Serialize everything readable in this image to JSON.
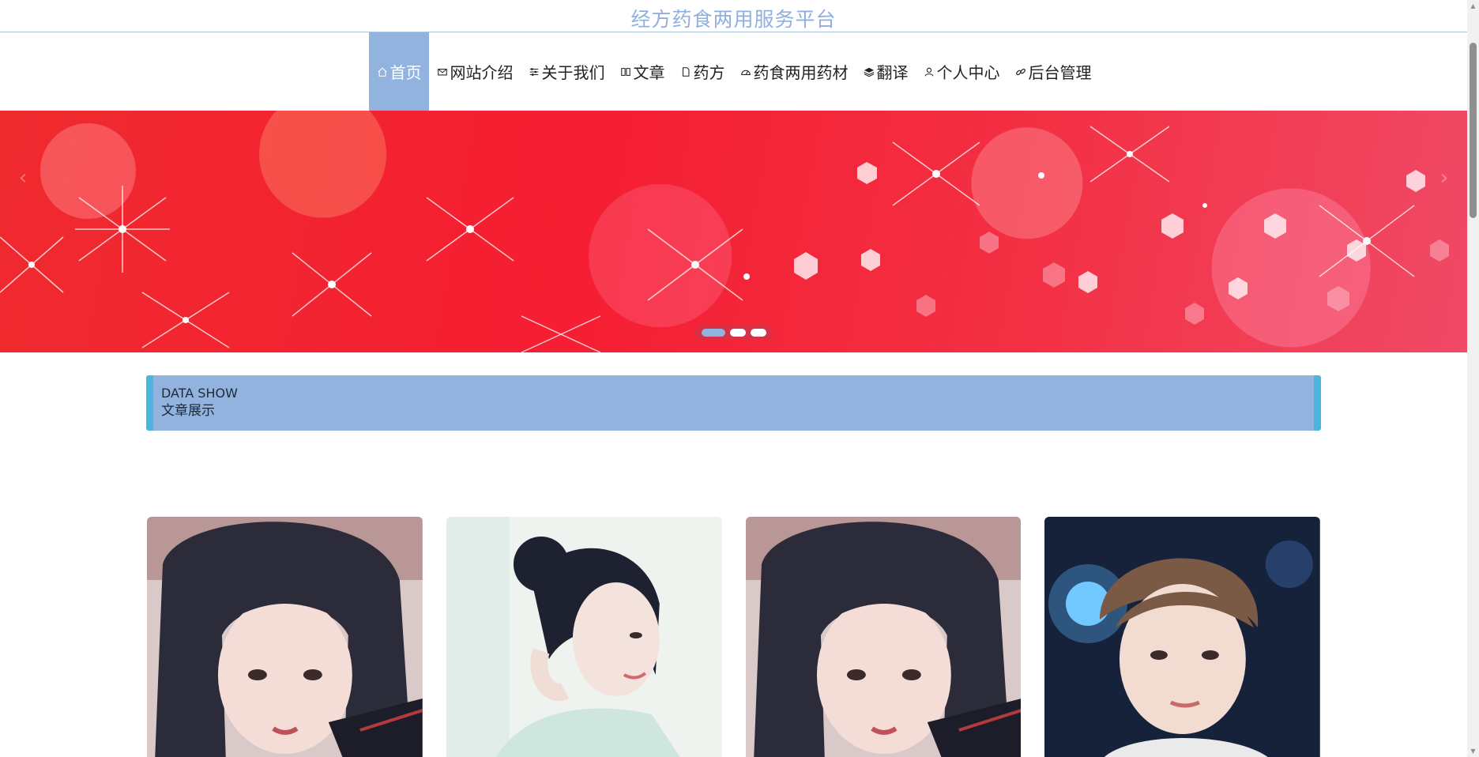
{
  "site": {
    "title": "经方药食两用服务平台"
  },
  "nav": {
    "items": [
      {
        "label": "首页",
        "icon": "home-icon",
        "active": true
      },
      {
        "label": "网站介绍",
        "icon": "envelope-icon",
        "active": false
      },
      {
        "label": "关于我们",
        "icon": "sliders-icon",
        "active": false
      },
      {
        "label": "文章",
        "icon": "book-icon",
        "active": false
      },
      {
        "label": "药方",
        "icon": "document-icon",
        "active": false
      },
      {
        "label": "药食两用药材",
        "icon": "gauge-icon",
        "active": false
      },
      {
        "label": "翻译",
        "icon": "layers-icon",
        "active": false
      },
      {
        "label": "个人中心",
        "icon": "user-icon",
        "active": false
      },
      {
        "label": "后台管理",
        "icon": "link-icon",
        "active": false
      }
    ]
  },
  "banner": {
    "slide_count": 3,
    "active_slide": 1,
    "colors": {
      "base": "#f51e32",
      "accent": "#93b3df"
    }
  },
  "section": {
    "title_en": "DATA SHOW",
    "title_cn": "文章展示"
  },
  "articles": [
    {
      "image": "portrait-girl-black-hair"
    },
    {
      "image": "portrait-woman-hair-bun"
    },
    {
      "image": "portrait-girl-black-hair"
    },
    {
      "image": "portrait-young-man-brown-hair"
    }
  ],
  "theme": {
    "primary": "#93b3df",
    "border": "#4ab6e0",
    "title": "#8fb0de"
  }
}
